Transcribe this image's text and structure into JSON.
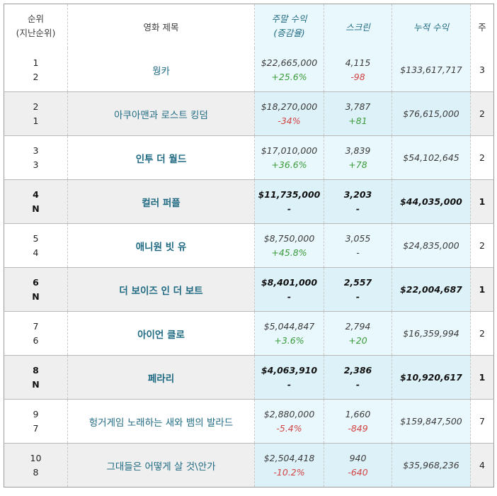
{
  "headers": {
    "rank": [
      "순위",
      "(지난순위)"
    ],
    "title": "영화 제목",
    "weekend": [
      "주말 수익",
      "(증감율)"
    ],
    "screens": "스크린",
    "total": "누적 수익",
    "weeks": "주"
  },
  "rows": [
    {
      "rank": "1",
      "prev": "2",
      "title": "웡카",
      "bold": false,
      "gross": "$22,665,000",
      "gross_change": "+25.6%",
      "gross_dir": "up",
      "screens": "4,115",
      "screens_change": "-98",
      "screens_dir": "down",
      "total": "$133,617,717",
      "weeks": "3"
    },
    {
      "rank": "2",
      "prev": "1",
      "title": "아쿠아맨과 로스트 킹덤",
      "bold": false,
      "gross": "$18,270,000",
      "gross_change": "-34%",
      "gross_dir": "down",
      "screens": "3,787",
      "screens_change": "+81",
      "screens_dir": "up",
      "total": "$76,615,000",
      "weeks": "2"
    },
    {
      "rank": "3",
      "prev": "3",
      "title": "인투 더 월드",
      "bold": true,
      "gross": "$17,010,000",
      "gross_change": "+36.6%",
      "gross_dir": "up",
      "screens": "3,839",
      "screens_change": "+78",
      "screens_dir": "up",
      "total": "$54,102,645",
      "weeks": "2"
    },
    {
      "rank": "4",
      "prev": "N",
      "title": "컬러 퍼플",
      "bold": true,
      "gross": "$11,735,000",
      "gross_change": "-",
      "gross_dir": "flat",
      "screens": "3,203",
      "screens_change": "-",
      "screens_dir": "flat",
      "total": "$44,035,000",
      "weeks": "1"
    },
    {
      "rank": "5",
      "prev": "4",
      "title": "애니원 빗 유",
      "bold": true,
      "gross": "$8,750,000",
      "gross_change": "+45.8%",
      "gross_dir": "up",
      "screens": "3,055",
      "screens_change": "-",
      "screens_dir": "flat",
      "total": "$24,835,000",
      "weeks": "2"
    },
    {
      "rank": "6",
      "prev": "N",
      "title": "더 보이즈 인 더 보트",
      "bold": true,
      "gross": "$8,401,000",
      "gross_change": "-",
      "gross_dir": "flat",
      "screens": "2,557",
      "screens_change": "-",
      "screens_dir": "flat",
      "total": "$22,004,687",
      "weeks": "1"
    },
    {
      "rank": "7",
      "prev": "6",
      "title": "아이언 클로",
      "bold": true,
      "gross": "$5,044,847",
      "gross_change": "+3.6%",
      "gross_dir": "up",
      "screens": "2,794",
      "screens_change": "+20",
      "screens_dir": "up",
      "total": "$16,359,994",
      "weeks": "2"
    },
    {
      "rank": "8",
      "prev": "N",
      "title": "페라리",
      "bold": true,
      "gross": "$4,063,910",
      "gross_change": "-",
      "gross_dir": "flat",
      "screens": "2,386",
      "screens_change": "-",
      "screens_dir": "flat",
      "total": "$10,920,617",
      "weeks": "1"
    },
    {
      "rank": "9",
      "prev": "7",
      "title": "헝거게임 노래하는 새와 뱀의 발라드",
      "bold": false,
      "gross": "$2,880,000",
      "gross_change": "-5.4%",
      "gross_dir": "down",
      "screens": "1,660",
      "screens_change": "-849",
      "screens_dir": "down",
      "total": "$159,847,500",
      "weeks": "7"
    },
    {
      "rank": "10",
      "prev": "8",
      "title": "그대들은 어떻게 살 것\\안가",
      "bold": false,
      "gross": "$2,504,418",
      "gross_change": "-10.2%",
      "gross_dir": "down",
      "screens": "940",
      "screens_change": "-640",
      "screens_dir": "down",
      "total": "$35,968,236",
      "weeks": "4"
    }
  ],
  "colors": {
    "accent": "#1f6a82",
    "up": "#3a9b3a",
    "down": "#d24444",
    "highlight_col": "#e9f8fd"
  }
}
